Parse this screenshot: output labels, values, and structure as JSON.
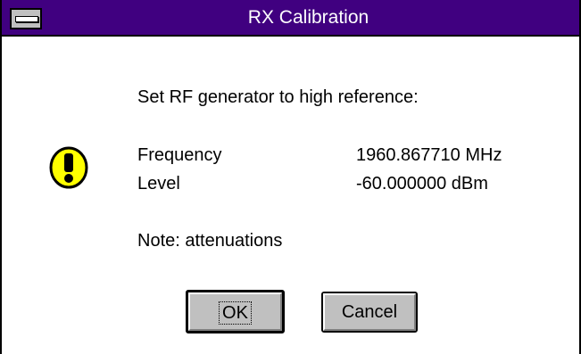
{
  "window": {
    "title": "RX Calibration",
    "colors": {
      "titlebar": "#400080",
      "title_text": "#ffffff",
      "button_face": "#c0c0c0",
      "icon_fill": "#ffff00"
    }
  },
  "icons": {
    "system_menu": "system-menu-icon",
    "warning": "exclamation-icon"
  },
  "message": {
    "instruction": "Set RF generator to high reference:",
    "rows": [
      {
        "label": "Frequency",
        "value": "1960.867710 MHz"
      },
      {
        "label": "Level",
        "value": "-60.000000 dBm"
      }
    ],
    "note": "Note: attenuations"
  },
  "buttons": {
    "ok_label": "OK",
    "cancel_label": "Cancel"
  }
}
